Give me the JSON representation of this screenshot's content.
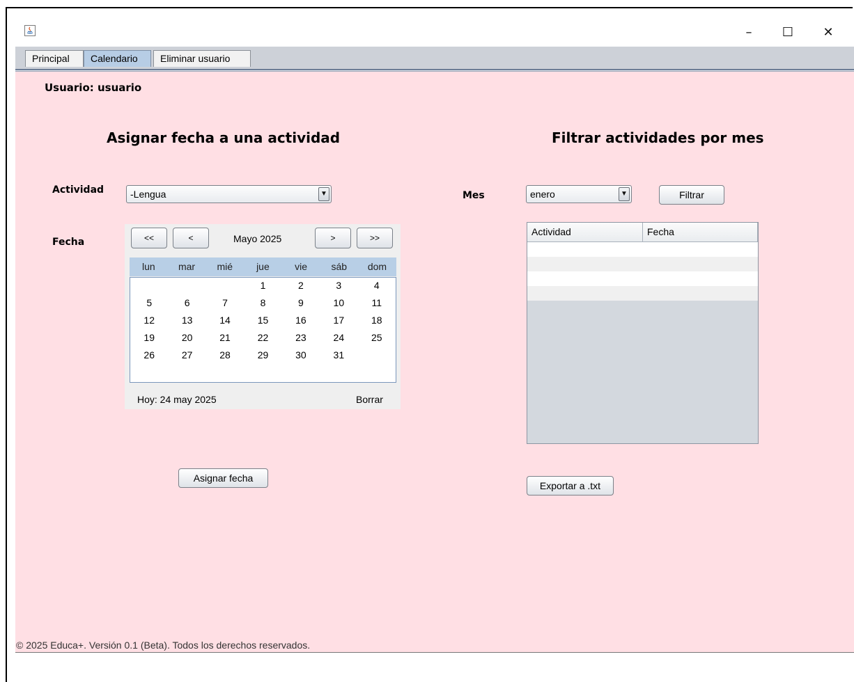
{
  "window": {
    "minimize_glyph": "–",
    "maximize_glyph": "☐",
    "close_glyph": "✕"
  },
  "tabs": [
    {
      "label": "Principal"
    },
    {
      "label": "Calendario"
    },
    {
      "label": "Eliminar usuario"
    }
  ],
  "user_label": "Usuario: usuario",
  "assign": {
    "title": "Asignar fecha a una actividad",
    "activity_label": "Actividad",
    "activity_value": "-Lengua",
    "date_label": "Fecha",
    "assign_button": "Asignar fecha"
  },
  "calendar": {
    "prev_year": "<<",
    "prev_month": "<",
    "month_label": "Mayo  2025",
    "next_month": ">",
    "next_year": ">>",
    "weekdays": [
      "lun",
      "mar",
      "mié",
      "jue",
      "vie",
      "sáb",
      "dom"
    ],
    "weeks": [
      [
        "",
        "",
        "",
        "1",
        "2",
        "3",
        "4"
      ],
      [
        "5",
        "6",
        "7",
        "8",
        "9",
        "10",
        "11"
      ],
      [
        "12",
        "13",
        "14",
        "15",
        "16",
        "17",
        "18"
      ],
      [
        "19",
        "20",
        "21",
        "22",
        "23",
        "24",
        "25"
      ],
      [
        "26",
        "27",
        "28",
        "29",
        "30",
        "31",
        ""
      ]
    ],
    "today_label": "Hoy:  24 may 2025",
    "clear_label": "Borrar"
  },
  "filter": {
    "title": "Filtrar actividades por mes",
    "month_label": "Mes",
    "month_value": "enero",
    "filter_button": "Filtrar",
    "columns": [
      "Actividad",
      "Fecha"
    ],
    "export_button": "Exportar a .txt"
  },
  "footer": "© 2025 Educa+. Versión 0.1 (Beta). Todos los derechos reservados."
}
